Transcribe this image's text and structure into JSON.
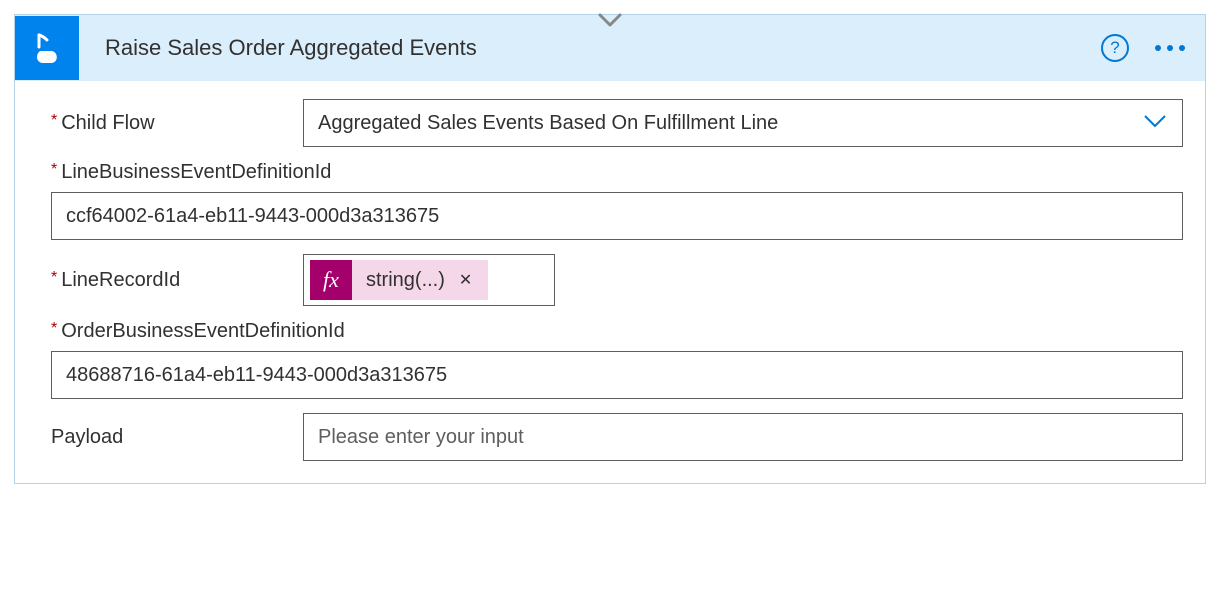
{
  "header": {
    "title": "Raise Sales Order Aggregated Events"
  },
  "fields": {
    "childFlow": {
      "label": "Child Flow",
      "value": "Aggregated Sales Events Based On Fulfillment Line"
    },
    "lineBusinessEventDefinitionId": {
      "label": "LineBusinessEventDefinitionId",
      "value": "ccf64002-61a4-eb11-9443-000d3a313675"
    },
    "lineRecordId": {
      "label": "LineRecordId",
      "expression": "string(...)"
    },
    "orderBusinessEventDefinitionId": {
      "label": "OrderBusinessEventDefinitionId",
      "value": "48688716-61a4-eb11-9443-000d3a313675"
    },
    "payload": {
      "label": "Payload",
      "placeholder": "Please enter your input"
    }
  },
  "icons": {
    "fx": "fx",
    "help": "?"
  }
}
